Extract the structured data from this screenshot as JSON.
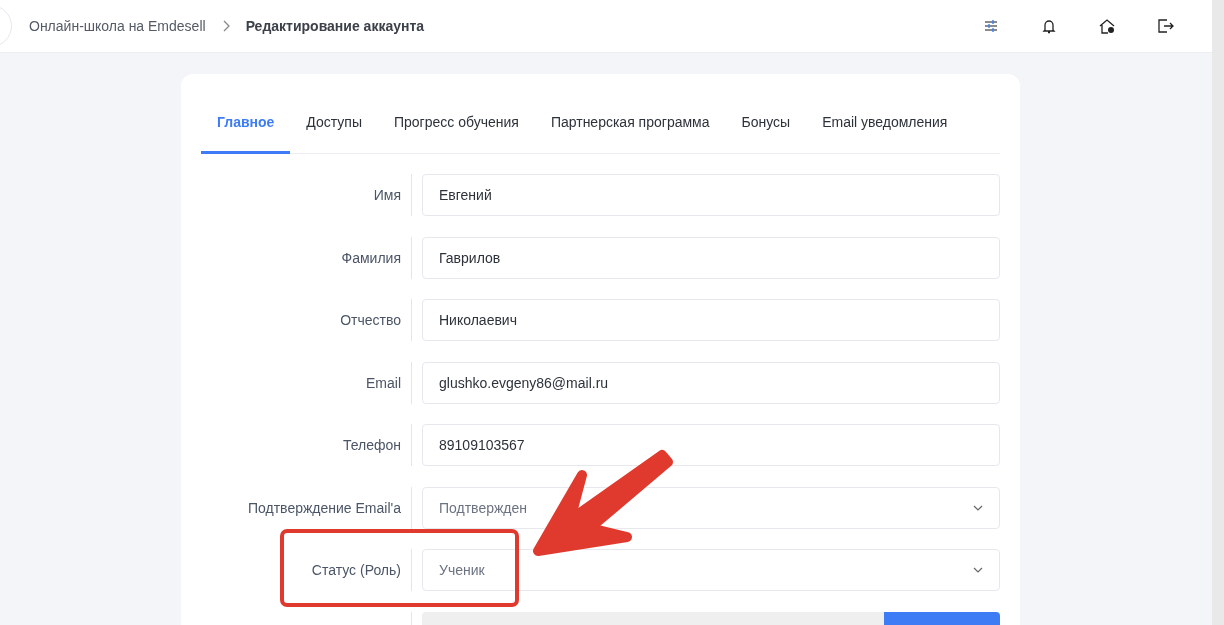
{
  "breadcrumb": {
    "parent": "Онлайн-школа на Emdesell",
    "current": "Редактирование аккаунта"
  },
  "tabs": [
    {
      "label": "Главное",
      "selected": true
    },
    {
      "label": "Доступы",
      "selected": false
    },
    {
      "label": "Прогресс обучения",
      "selected": false
    },
    {
      "label": "Партнерская программа",
      "selected": false
    },
    {
      "label": "Бонусы",
      "selected": false
    },
    {
      "label": "Email уведомления",
      "selected": false
    }
  ],
  "fields": [
    {
      "kind": "text",
      "label": "Имя",
      "value": "Евгений"
    },
    {
      "kind": "text",
      "label": "Фамилия",
      "value": "Гаврилов"
    },
    {
      "kind": "text",
      "label": "Отчество",
      "value": "Николаевич"
    },
    {
      "kind": "text",
      "label": "Email",
      "value": "glushko.evgeny86@mail.ru"
    },
    {
      "kind": "text",
      "label": "Телефон",
      "value": "89109103567"
    },
    {
      "kind": "select",
      "label": "Подтверждение Email'a",
      "value": "Подтвержден"
    },
    {
      "kind": "select",
      "label": "Статус (Роль)",
      "value": "Ученик"
    }
  ]
}
